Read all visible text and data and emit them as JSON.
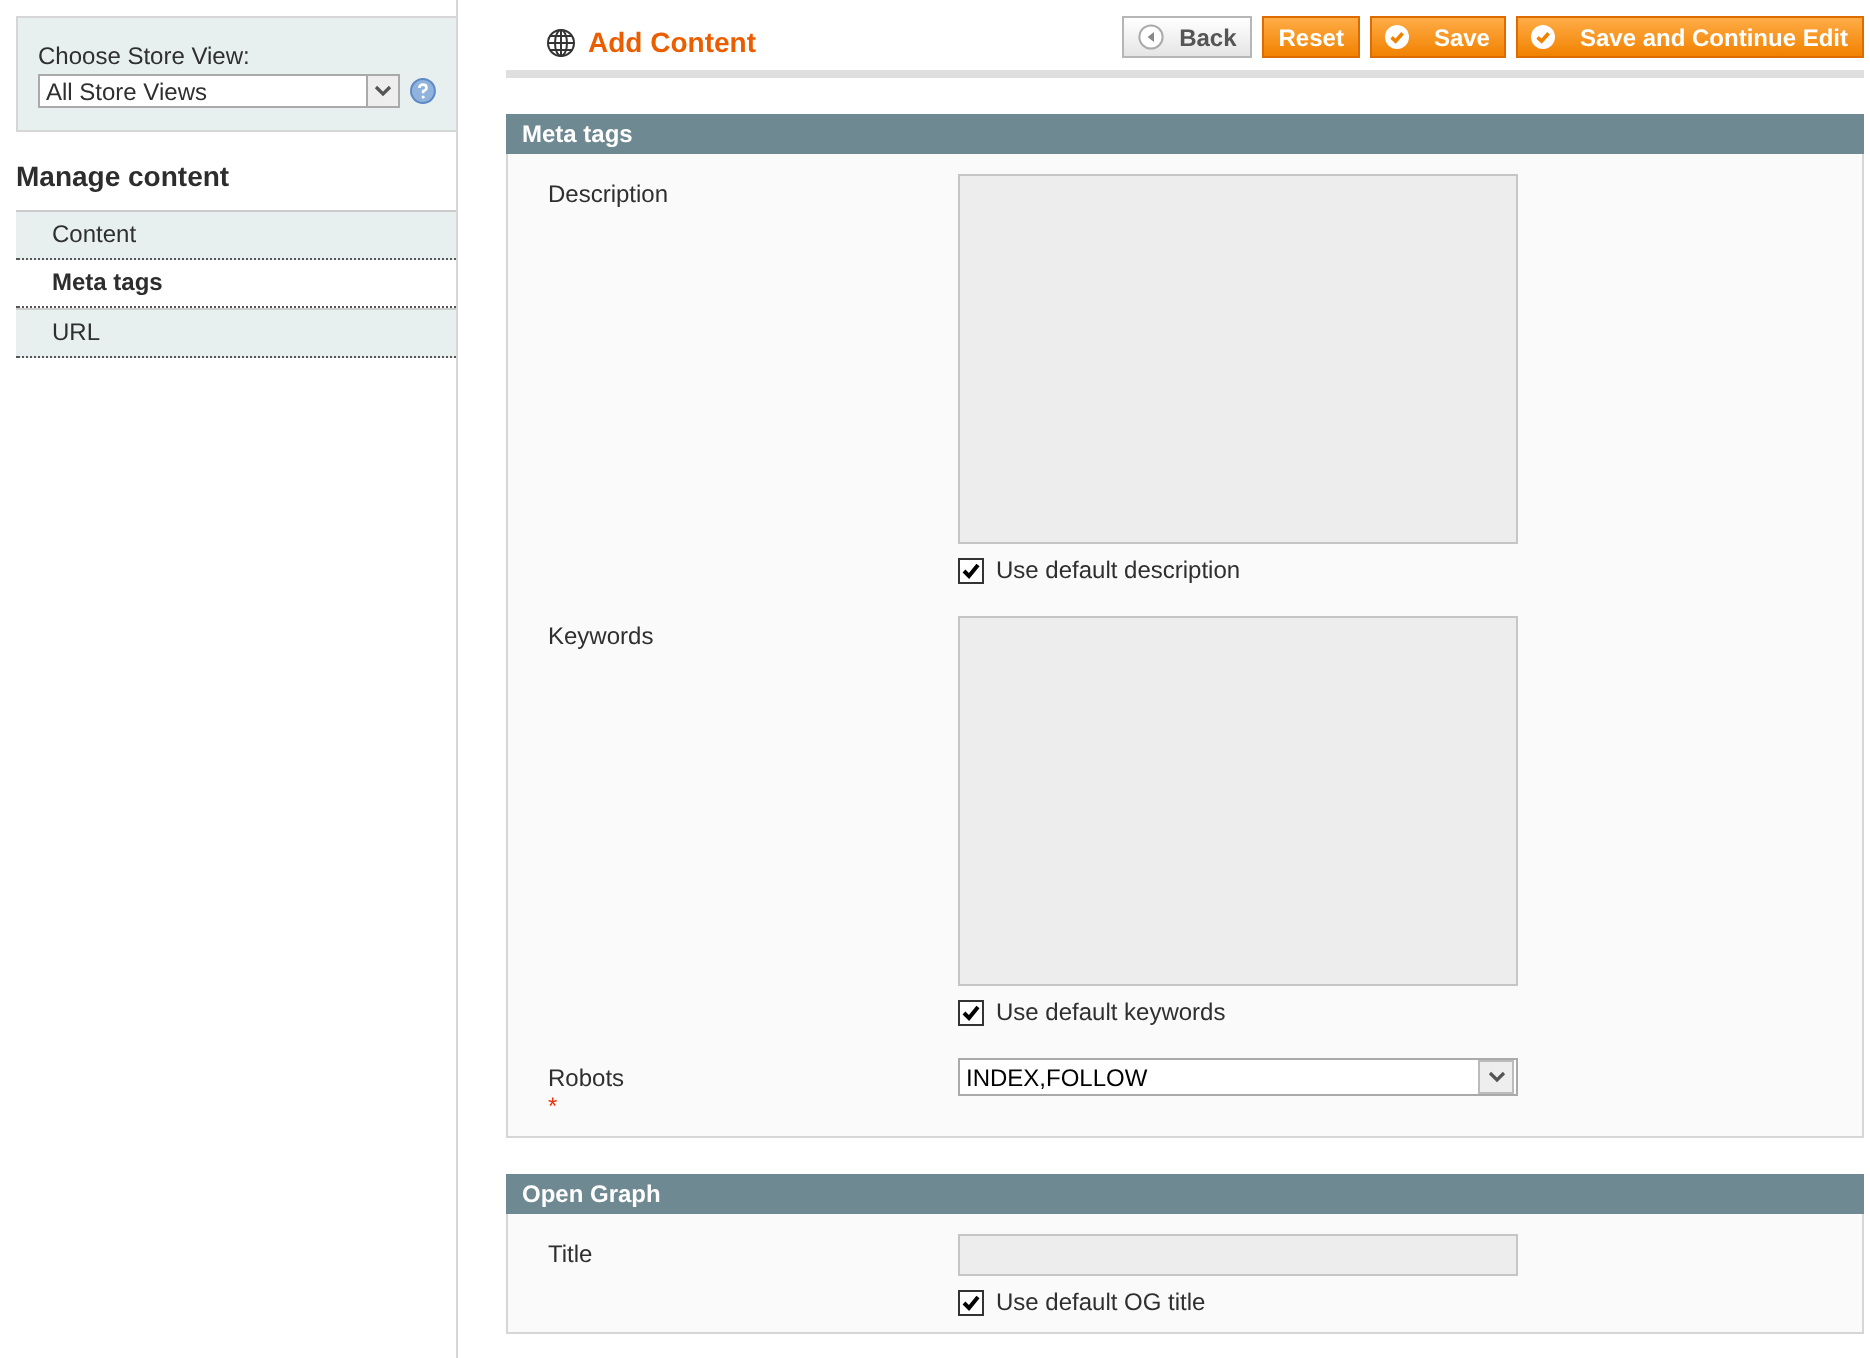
{
  "store_switcher": {
    "label": "Choose Store View:",
    "value": "All Store Views"
  },
  "sidebar": {
    "title": "Manage content",
    "tabs": [
      {
        "label": "Content",
        "selected": false
      },
      {
        "label": "Meta tags",
        "selected": true
      },
      {
        "label": "URL",
        "selected": false
      }
    ]
  },
  "header": {
    "title": "Add Content",
    "buttons": [
      {
        "label": "Back",
        "kind": "back"
      },
      {
        "label": "Reset",
        "kind": "plain"
      },
      {
        "label": "Save",
        "kind": "save"
      },
      {
        "label": "Save and Continue Edit",
        "kind": "save"
      }
    ]
  },
  "sections": [
    {
      "title": "Meta tags",
      "fields": [
        {
          "kind": "textarea",
          "label": "Description",
          "disabled": true,
          "checkbox": {
            "label": "Use default description",
            "checked": true
          }
        },
        {
          "kind": "textarea",
          "label": "Keywords",
          "disabled": true,
          "checkbox": {
            "label": "Use default keywords",
            "checked": true
          }
        },
        {
          "kind": "select",
          "label": "Robots",
          "required_mark": "*",
          "value": "INDEX,FOLLOW"
        }
      ]
    },
    {
      "title": "Open Graph",
      "fields": [
        {
          "kind": "text",
          "label": "Title",
          "disabled": true,
          "checkbox": {
            "label": "Use default OG title",
            "checked": true
          }
        }
      ]
    }
  ]
}
